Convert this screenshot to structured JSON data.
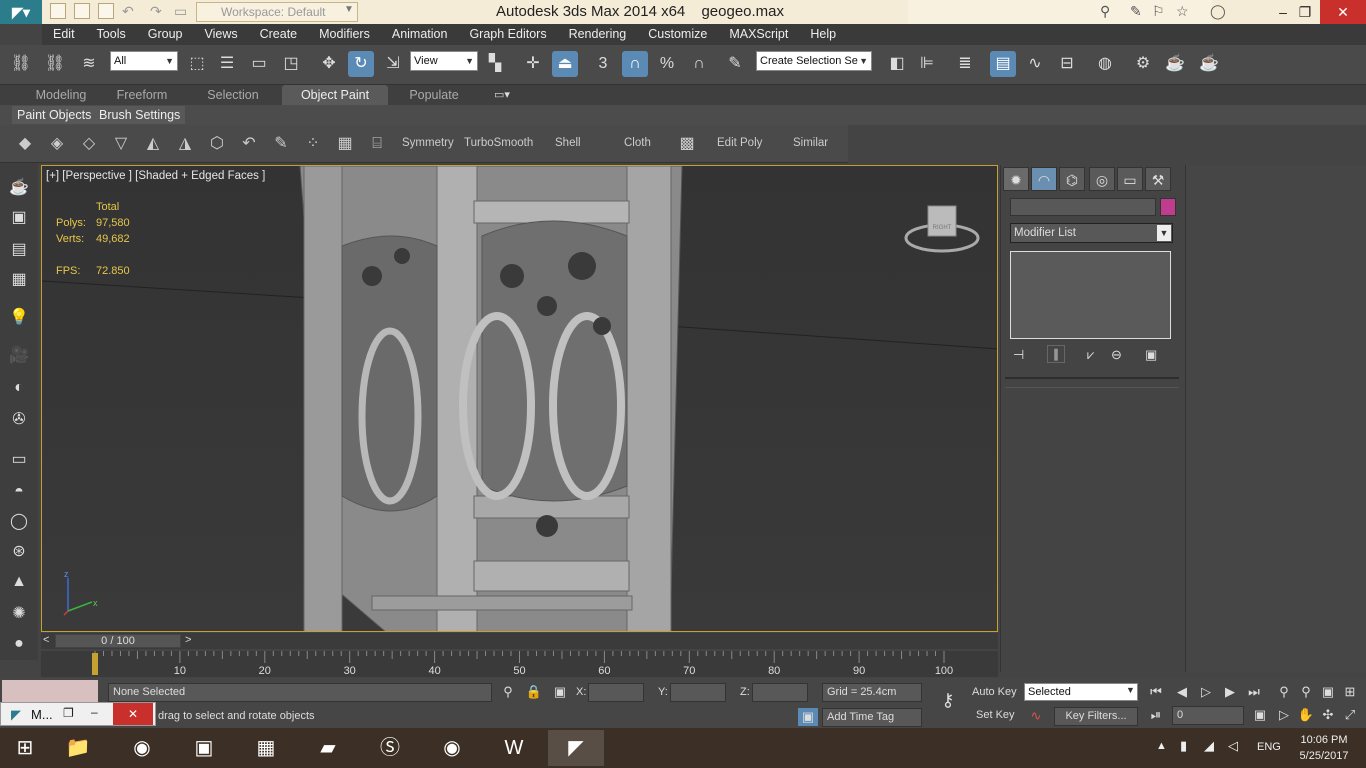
{
  "titlebar": {
    "app_title": "Autodesk 3ds Max  2014 x64",
    "file_name": "geogeo.max",
    "workspace": "Workspace: Default"
  },
  "menu": [
    "Edit",
    "Tools",
    "Group",
    "Views",
    "Create",
    "Modifiers",
    "Animation",
    "Graph Editors",
    "Rendering",
    "Customize",
    "MAXScript",
    "Help"
  ],
  "toolbar": {
    "selection_filter": "All",
    "ref_coord": "View",
    "snap_3": "3",
    "snap_pct": "%",
    "named_selection": "Create Selection Se"
  },
  "ribbon": {
    "tabs": [
      "Modeling",
      "Freeform",
      "Selection",
      "Object Paint",
      "Populate"
    ],
    "subtabs": [
      "Paint Objects",
      "Brush Settings"
    ],
    "panel_labels": [
      "Symmetry",
      "TurboSmooth",
      "Shell",
      "Cloth",
      "Edit Poly",
      "Similar"
    ]
  },
  "viewport": {
    "label": "[+] [Perspective ] [Shaded + Edged Faces ]",
    "stats_header": "Total",
    "polys_label": "Polys:",
    "polys_value": "97,580",
    "verts_label": "Verts:",
    "verts_value": "49,682",
    "fps_label": "FPS:",
    "fps_value": "72.850",
    "viewcube_face": "RIGHT",
    "axis_x": "x",
    "axis_z": "z"
  },
  "timeline": {
    "prev": "<",
    "next": ">",
    "position": "0 / 100",
    "ticks": [
      "0",
      "10",
      "20",
      "30",
      "40",
      "50",
      "60",
      "70",
      "80",
      "90",
      "100"
    ]
  },
  "command_panel": {
    "modifier_list": "Modifier List",
    "color_swatch": "#c03c8c"
  },
  "status": {
    "selection": "None Selected",
    "prompt": "drag to select and rotate objects",
    "x_label": "X:",
    "y_label": "Y:",
    "z_label": "Z:",
    "grid": "Grid = 25.4cm",
    "add_time_tag": "Add Time Tag",
    "auto_key": "Auto Key",
    "set_key": "Set Key",
    "key_mode": "Selected",
    "key_filters": "Key Filters...",
    "frame_value": "0",
    "mini_listener": "M..."
  },
  "taskbar": {
    "time": "10:06 PM",
    "date": "5/25/2017",
    "lang": "ENG"
  }
}
